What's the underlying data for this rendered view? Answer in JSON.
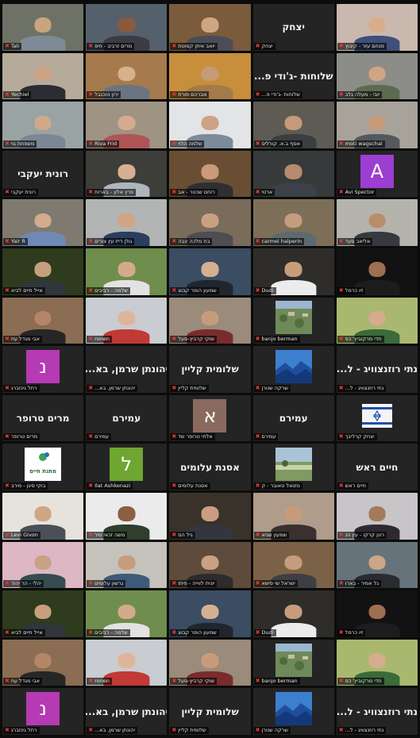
{
  "participants": [
    {
      "name": "Tali",
      "type": "video",
      "bg": "#6e7266",
      "skin": "#c9a47f",
      "shirt": "#7d8b96"
    },
    {
      "name": "מרים זרביב - חיפ",
      "type": "video",
      "bg": "#55606d",
      "skin": "#8a5a3c",
      "shirt": "#3b3b44"
    },
    {
      "name": "יואב איתן קסוטת",
      "type": "video",
      "bg": "#7a5b3c",
      "skin": "#d1a583",
      "shirt": "#4b4c57"
    },
    {
      "name": "יצחק",
      "type": "display",
      "display": "יצחק"
    },
    {
      "name": "מנחם עזר - קיבוץ",
      "type": "video",
      "bg": "#c9b8ae",
      "skin": "#d9ad8c",
      "shirt": "#3e4f7a"
    },
    {
      "name": "Yechiel",
      "type": "video",
      "bg": "#b6ab9a",
      "skin": "#cfa283",
      "shirt": "#2c2d34"
    },
    {
      "name": "ירון הוכנבל",
      "type": "video",
      "bg": "#a57a4d",
      "skin": "#d7b08d",
      "shirt": "#6a7482"
    },
    {
      "name": "אברהם פורת",
      "type": "video",
      "bg": "#c78e3c",
      "skin": "#c69a76",
      "shirt": "#a37b4a"
    },
    {
      "name": "שלוחות -ג'ודי פ...",
      "type": "display",
      "display": "שלוחות -ג'ודי פ..."
    },
    {
      "name": "יובי - מעלה גלב",
      "type": "video",
      "bg": "#8c8d88",
      "skin": "#d0a584",
      "shirt": "#5c6b50"
    },
    {
      "name": "משפחת גוי",
      "type": "video",
      "bg": "#9aa3a4",
      "skin": "#d1a98a",
      "shirt": "#7b8795"
    },
    {
      "name": "Riva Frid",
      "type": "video",
      "bg": "#9f9384",
      "skin": "#d4ab8f",
      "shirt": "#b05555"
    },
    {
      "name": "שלמה הלוי",
      "type": "video",
      "bg": "#e3e4e6",
      "skin": "#cfa186",
      "shirt": "#7c8a9a"
    },
    {
      "name": "אסף ב.א. קורליס",
      "type": "video",
      "bg": "#5d5b54",
      "skin": "#c49a7a",
      "shirt": "#3b3d40"
    },
    {
      "name": "moti wagschal",
      "type": "video",
      "bg": "#a8a39a",
      "skin": "#c79b7a",
      "shirt": "#54595e"
    },
    {
      "name": "רונית יעקבי",
      "type": "display",
      "display": "רונית יעקבי"
    },
    {
      "name": "פרץ אלון - בארות",
      "type": "video",
      "bg": "#3d3d3a",
      "skin": "#d6b093",
      "shirt": "#aeb6bd"
    },
    {
      "name": "רוחם שכטר - אב",
      "type": "video",
      "bg": "#6a4e34",
      "skin": "#c99b7b",
      "shirt": "#2f2f33"
    },
    {
      "name": "ארטי",
      "type": "video",
      "bg": "#363a3a",
      "skin": "#b68b6e",
      "shirt": "#3c4048"
    },
    {
      "name": "Avi Spector",
      "type": "avatar",
      "letter": "A",
      "color": "#9b3ed1"
    },
    {
      "name": "Yair R",
      "type": "video",
      "bg": "#7e7a70",
      "skin": "#d2ac8e",
      "shirt": "#6f89b5",
      "active": true
    },
    {
      "name": "גולן רייז עין צורים",
      "type": "video",
      "bg": "#b2b5b4",
      "skin": "#d0a585",
      "shirt": "#2a3d5d"
    },
    {
      "name": "בת מלכה יגבה",
      "type": "video",
      "bg": "#7a6c5a",
      "skin": "#caa084",
      "shirt": "#4d4d52"
    },
    {
      "name": "carmel halperin",
      "type": "video",
      "bg": "#7d6f57",
      "skin": "#c59d7e",
      "shirt": "#5d6b70"
    },
    {
      "name": "אליאב סעד",
      "type": "video",
      "bg": "#b4b4ac",
      "skin": "#b98c6b",
      "shirt": "#363a3e"
    },
    {
      "name": "אייל חיים לביא",
      "type": "video",
      "bg": "#2e3b1d",
      "skin": "#c79f7e",
      "shirt": "#30363a"
    },
    {
      "name": "שלמה - רביבים",
      "type": "video",
      "bg": "#6f8d4c",
      "skin": "#d3ab8b",
      "shirt": "#e2e2e2"
    },
    {
      "name": "שמעון הופר קבוצ",
      "type": "video",
      "bg": "#3a4d62",
      "skin": "#d5af92",
      "shirt": "#20252e"
    },
    {
      "name": "Dudi",
      "type": "video",
      "bg": "#2e2d2a",
      "skin": "#c79d7b",
      "shirt": "#ececec"
    },
    {
      "name": "זיו כרמל",
      "type": "video",
      "bg": "#121212",
      "skin": "#9d6f52",
      "shirt": "#1d1d1d"
    },
    {
      "name": "אבי מגדל עוז",
      "type": "video",
      "bg": "#8a6d52",
      "skin": "#b58568",
      "shirt": "#262626"
    },
    {
      "name": "ronen",
      "type": "video",
      "bg": "#c9ccd0",
      "skin": "#e0b49a",
      "shirt": "#c23a35"
    },
    {
      "name": "שוקי קרביץ-סעל",
      "type": "video",
      "bg": "#9a8b7a",
      "skin": "#c69b7c",
      "shirt": "#7a2c2c"
    },
    {
      "name": "banjo berman",
      "type": "image",
      "image": "aerial"
    },
    {
      "name": "חדי מרקוביץ' כפ",
      "type": "video",
      "bg": "#aab86f",
      "skin": "#d5ac8e",
      "shirt": "#3b6a3b"
    },
    {
      "name": "רחל גינזברג",
      "type": "avatar",
      "letter": "נ",
      "color": "#b53ab3"
    },
    {
      "name": "יהונתן שרמן, בא...",
      "type": "display",
      "display": "יהונתן שרמן, בא..."
    },
    {
      "name": "שלומית קליין",
      "type": "display",
      "display": "שלומית קליין"
    },
    {
      "name": "שרקה שטרן",
      "type": "image",
      "image": "mountains"
    },
    {
      "name": "נתי רוזנצוויג - ל...",
      "type": "display",
      "display": "נתי רוזנצוויג - ל..."
    },
    {
      "name": "מרים טרופר",
      "type": "display",
      "display": "מרים טרופר"
    },
    {
      "name": "עמירם",
      "type": "display",
      "display": "עמירם"
    },
    {
      "name": "אלחי טרופר שד",
      "type": "avatar",
      "letter": "א",
      "color": "#8a6a5e"
    },
    {
      "name": "עמירם",
      "type": "display",
      "display": "עמירם"
    },
    {
      "name": "יצחק קרליבך",
      "type": "image",
      "image": "flag"
    },
    {
      "name": "בוקי סיגן - מירב",
      "type": "image",
      "image": "logo",
      "logo_text": "מתנת חיים"
    },
    {
      "name": "Ilat Ashkenazi",
      "type": "avatar",
      "letter": "ל",
      "color": "#6ea631"
    },
    {
      "name": "אסנת עלומים",
      "type": "display",
      "display": "אסנת עלומים"
    },
    {
      "name": "נתנאל טאובר - ק",
      "type": "image",
      "image": "landscape"
    },
    {
      "name": "חיים ראש",
      "type": "display",
      "display": "חיים ראש"
    },
    {
      "name": "Levi Givon",
      "type": "video",
      "bg": "#e6e3dd",
      "skin": "#cfa584",
      "shirt": "#4b4f57"
    },
    {
      "name": "משה זכאי טיר",
      "type": "video",
      "bg": "#ebebeb",
      "skin": "#8b5f44",
      "shirt": "#2f3e2d"
    },
    {
      "name": "גיל הס",
      "type": "video",
      "bg": "#38322b",
      "skin": "#c99d80",
      "shirt": "#33373d"
    },
    {
      "name": "שמעון שגיא",
      "type": "video",
      "bg": "#b09c8a",
      "skin": "#c79b7a",
      "shirt": "#3a3030"
    },
    {
      "name": "רונן קרקו - עין הנ",
      "type": "video",
      "bg": "#c8c5c8",
      "skin": "#a37a5b",
      "shirt": "#2c2a30"
    },
    {
      "name": "יהלי - הר יהוד",
      "type": "video",
      "bg": "#ddb7c3",
      "skin": "#c9a183",
      "shirt": "#364c52"
    },
    {
      "name": "גרשון עלומים",
      "type": "video",
      "bg": "#c5c2bc",
      "skin": "#c79c7b",
      "shirt": "#3e5a78"
    },
    {
      "name": "יונית לווייה - פיתו",
      "type": "video",
      "bg": "#5e4b3c",
      "skin": "#caa085",
      "shirt": "#2e2b2b"
    },
    {
      "name": "ישראל שי פישא",
      "type": "video",
      "bg": "#7b6246",
      "skin": "#c69c7e",
      "shirt": "#3d3f44"
    },
    {
      "name": "גל אמיר - בארו",
      "type": "video",
      "bg": "#67737a",
      "skin": "#cda587",
      "shirt": "#2a2b30"
    },
    {
      "name": "אייל חיים לביא",
      "type": "video",
      "bg": "#2e3b1d",
      "skin": "#c79f7e",
      "shirt": "#30363a"
    },
    {
      "name": "שלמה - רביבים",
      "type": "video",
      "bg": "#6f8d4c",
      "skin": "#d3ab8b",
      "shirt": "#e2e2e2"
    },
    {
      "name": "שמעון הופר קבוצ",
      "type": "video",
      "bg": "#3a4d62",
      "skin": "#d5af92",
      "shirt": "#20252e"
    },
    {
      "name": "Dudi",
      "type": "video",
      "bg": "#2e2d2a",
      "skin": "#c79d7b",
      "shirt": "#ececec"
    },
    {
      "name": "זיו כרמל",
      "type": "video",
      "bg": "#121212",
      "skin": "#9d6f52",
      "shirt": "#1d1d1d"
    },
    {
      "name": "אבי מגדל עוז",
      "type": "video",
      "bg": "#8a6d52",
      "skin": "#b58568",
      "shirt": "#262626"
    },
    {
      "name": "ronen",
      "type": "video",
      "bg": "#c9ccd0",
      "skin": "#e0b49a",
      "shirt": "#c23a35"
    },
    {
      "name": "שוקי קרביץ-סעל",
      "type": "video",
      "bg": "#9a8b7a",
      "skin": "#c69b7c",
      "shirt": "#7a2c2c"
    },
    {
      "name": "banjo berman",
      "type": "image",
      "image": "aerial"
    },
    {
      "name": "חדי מרקוביץ' כפ",
      "type": "video",
      "bg": "#aab86f",
      "skin": "#d5ac8e",
      "shirt": "#3b6a3b"
    },
    {
      "name": "רחל גינזברג",
      "type": "avatar",
      "letter": "נ",
      "color": "#b53ab3"
    },
    {
      "name": "יהונתן שרמן, בא...",
      "type": "display",
      "display": "יהונתן שרמן, בא..."
    },
    {
      "name": "שלומית קליין",
      "type": "display",
      "display": "שלומית קליין"
    },
    {
      "name": "שרקה שטרן",
      "type": "image",
      "image": "mountains"
    },
    {
      "name": "נתי רוזנצוויג - ל...",
      "type": "display",
      "display": "נתי רוזנצוויג - ל..."
    }
  ],
  "colors": {
    "tile_bg": "#242424",
    "active_border": "#c8d26a",
    "muted_mic": "#e53935"
  },
  "icons": {
    "muted": "mic-muted-icon"
  }
}
